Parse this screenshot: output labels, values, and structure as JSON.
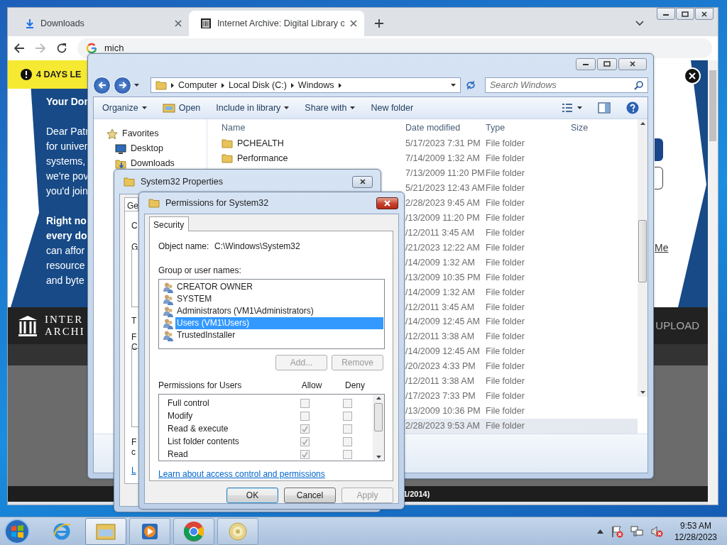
{
  "browser": {
    "tabs": [
      {
        "kind": "download",
        "label": "Downloads",
        "selected": false
      },
      {
        "kind": "archive",
        "label": "Internet Archive: Digital Library o",
        "selected": true
      }
    ],
    "address": "mich",
    "forward_disabled": true,
    "page": {
      "banner": "4 DAYS LE",
      "heading": "Your Dor",
      "intro": [
        "Dear Patr",
        "for univer",
        "systems,",
        "we're pov",
        "you'd join"
      ],
      "appeal": [
        {
          "text": "Right no",
          "bold": true
        },
        {
          "text": "every do",
          "bold": true
        },
        {
          "text": "can affor",
          "bold": false
        },
        {
          "text": "resource",
          "bold": false
        },
        {
          "text": "and byte",
          "bold": false
        }
      ],
      "logo": [
        "INTER",
        "ARCHI"
      ],
      "link": "Me",
      "nav_item": "UPLOAD",
      "footer": "1/2014)"
    }
  },
  "explorer": {
    "path": [
      "Computer",
      "Local Disk (C:)",
      "Windows"
    ],
    "search_placeholder": "Search Windows",
    "toolbar": [
      {
        "label": "Organize",
        "kind": "menu"
      },
      {
        "label": "Open",
        "kind": "open"
      },
      {
        "label": "Include in library",
        "kind": "menu"
      },
      {
        "label": "Share with",
        "kind": "menu"
      },
      {
        "label": "New folder",
        "kind": "plain"
      }
    ],
    "nav": [
      {
        "label": "Favorites",
        "kind": "favorites"
      },
      {
        "label": "Desktop",
        "kind": "desktop"
      },
      {
        "label": "Downloads",
        "kind": "downloads"
      }
    ],
    "columns": [
      "Name",
      "Date modified",
      "Type",
      "Size"
    ],
    "rows": [
      {
        "name": "PCHEALTH",
        "date": "5/17/2023 7:31 PM",
        "type": "File folder",
        "selected": false
      },
      {
        "name": "Performance",
        "date": "7/14/2009 1:32 AM",
        "type": "File folder",
        "selected": false
      },
      {
        "date": "7/13/2009 11:20 PM",
        "type": "File folder",
        "selected": false
      },
      {
        "date": "5/21/2023 12:43 AM",
        "type": "File folder",
        "selected": false
      },
      {
        "date": "2/28/2023 9:45 AM",
        "type": "File folder",
        "selected": false
      },
      {
        "date": "/13/2009 11:20 PM",
        "type": "File folder",
        "selected": false
      },
      {
        "date": "/12/2011 3:45 AM",
        "type": "File folder",
        "selected": false
      },
      {
        "date": "/21/2023 12:22 AM",
        "type": "File folder",
        "selected": false
      },
      {
        "date": "/14/2009 1:32 AM",
        "type": "File folder",
        "selected": false
      },
      {
        "date": "/13/2009 10:35 PM",
        "type": "File folder",
        "selected": false
      },
      {
        "date": "/14/2009 1:32 AM",
        "type": "File folder",
        "selected": false
      },
      {
        "date": "/12/2011 3:45 AM",
        "type": "File folder",
        "selected": false
      },
      {
        "date": "/14/2009 12:45 AM",
        "type": "File folder",
        "selected": false
      },
      {
        "date": "/12/2011 3:38 AM",
        "type": "File folder",
        "selected": false
      },
      {
        "date": "/14/2009 12:45 AM",
        "type": "File folder",
        "selected": false
      },
      {
        "date": "/20/2023 4:33 PM",
        "type": "File folder",
        "selected": false
      },
      {
        "date": "/12/2011 3:38 AM",
        "type": "File folder",
        "selected": false
      },
      {
        "date": "/17/2023 7:33 PM",
        "type": "File folder",
        "selected": false
      },
      {
        "date": "/13/2009 10:36 PM",
        "type": "File folder",
        "selected": false
      },
      {
        "date": "2/28/2023 9:53 AM",
        "type": "File folder",
        "selected": true
      }
    ]
  },
  "properties": {
    "title": "System32 Properties",
    "tab": "Ge",
    "fragments": [
      {
        "text": "C",
        "kind": "text"
      },
      {
        "text": "G",
        "kind": "text"
      },
      {
        "text": "T",
        "kind": "text"
      },
      {
        "text": "F",
        "kind": "text"
      },
      {
        "text": "C",
        "kind": "text"
      },
      {
        "text": "F",
        "kind": "text"
      },
      {
        "text": "c",
        "kind": "text"
      },
      {
        "text": "L",
        "kind": "link"
      }
    ]
  },
  "permissions": {
    "title": "Permissions for System32",
    "tab": "Security",
    "object_label": "Object name:",
    "object_value": "C:\\Windows\\System32",
    "groups_label": "Group or user names:",
    "groups": [
      {
        "label": "CREATOR OWNER",
        "selected": false
      },
      {
        "label": "SYSTEM",
        "selected": false
      },
      {
        "label": "Administrators (VM1\\Administrators)",
        "selected": false
      },
      {
        "label": "Users (VM1\\Users)",
        "selected": true
      },
      {
        "label": "TrustedInstaller",
        "selected": false
      }
    ],
    "group_buttons": [
      {
        "label": "Add...",
        "disabled": true
      },
      {
        "label": "Remove",
        "disabled": true
      }
    ],
    "perms_label": "Permissions for Users",
    "perm_columns": [
      "Allow",
      "Deny"
    ],
    "perms": [
      {
        "label": "Full control",
        "allow": false,
        "deny": false
      },
      {
        "label": "Modify",
        "allow": false,
        "deny": false
      },
      {
        "label": "Read & execute",
        "allow": true,
        "deny": false
      },
      {
        "label": "List folder contents",
        "allow": true,
        "deny": false
      },
      {
        "label": "Read",
        "allow": true,
        "deny": false
      }
    ],
    "link": "Learn about access control and permissions",
    "buttons": [
      {
        "label": "OK",
        "kind": "default",
        "disabled": false
      },
      {
        "label": "Cancel",
        "kind": "normal",
        "disabled": false
      },
      {
        "label": "Apply",
        "kind": "normal",
        "disabled": true
      }
    ]
  },
  "taskbar": {
    "apps": [
      {
        "kind": "ie",
        "running": false,
        "active": false
      },
      {
        "kind": "explorer",
        "running": true,
        "active": true
      },
      {
        "kind": "media",
        "running": true,
        "active": false
      },
      {
        "kind": "chrome",
        "running": true,
        "active": false
      },
      {
        "kind": "disc",
        "running": true,
        "active": false
      }
    ],
    "time": "9:53 AM",
    "date": "12/28/2023"
  }
}
